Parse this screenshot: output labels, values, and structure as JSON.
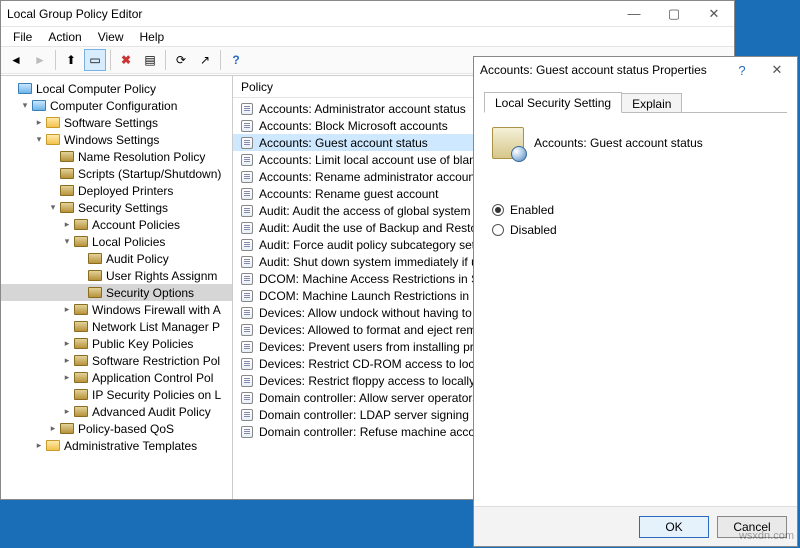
{
  "main": {
    "title": "Local Group Policy Editor",
    "menus": [
      "File",
      "Action",
      "View",
      "Help"
    ],
    "list_header": "Policy",
    "tree": [
      {
        "d": 0,
        "tw": "",
        "ico": "sp",
        "label": "Local Computer Policy"
      },
      {
        "d": 1,
        "tw": "▾",
        "ico": "sp",
        "label": "Computer Configuration"
      },
      {
        "d": 2,
        "tw": "▸",
        "ico": "folder",
        "label": "Software Settings"
      },
      {
        "d": 2,
        "tw": "▾",
        "ico": "folder",
        "label": "Windows Settings"
      },
      {
        "d": 3,
        "tw": "",
        "ico": "dk",
        "label": "Name Resolution Policy"
      },
      {
        "d": 3,
        "tw": "",
        "ico": "dk",
        "label": "Scripts (Startup/Shutdown)"
      },
      {
        "d": 3,
        "tw": "",
        "ico": "dk",
        "label": "Deployed Printers"
      },
      {
        "d": 3,
        "tw": "▾",
        "ico": "dk",
        "label": "Security Settings"
      },
      {
        "d": 4,
        "tw": "▸",
        "ico": "dk",
        "label": "Account Policies"
      },
      {
        "d": 4,
        "tw": "▾",
        "ico": "dk",
        "label": "Local Policies"
      },
      {
        "d": 5,
        "tw": "",
        "ico": "dk",
        "label": "Audit Policy"
      },
      {
        "d": 5,
        "tw": "",
        "ico": "dk",
        "label": "User Rights Assignm"
      },
      {
        "d": 5,
        "tw": "",
        "ico": "dk",
        "label": "Security Options",
        "sel": true
      },
      {
        "d": 4,
        "tw": "▸",
        "ico": "dk",
        "label": "Windows Firewall with A"
      },
      {
        "d": 4,
        "tw": "",
        "ico": "dk",
        "label": "Network List Manager P"
      },
      {
        "d": 4,
        "tw": "▸",
        "ico": "dk",
        "label": "Public Key Policies"
      },
      {
        "d": 4,
        "tw": "▸",
        "ico": "dk",
        "label": "Software Restriction Pol"
      },
      {
        "d": 4,
        "tw": "▸",
        "ico": "dk",
        "label": "Application Control Pol"
      },
      {
        "d": 4,
        "tw": "",
        "ico": "dk",
        "label": "IP Security Policies on L"
      },
      {
        "d": 4,
        "tw": "▸",
        "ico": "dk",
        "label": "Advanced Audit Policy"
      },
      {
        "d": 3,
        "tw": "▸",
        "ico": "dk",
        "label": "Policy-based QoS"
      },
      {
        "d": 2,
        "tw": "▸",
        "ico": "folder",
        "label": "Administrative Templates"
      }
    ],
    "policies": [
      "Accounts: Administrator account status",
      "Accounts: Block Microsoft accounts",
      "Accounts: Guest account status",
      "Accounts: Limit local account use of blan",
      "Accounts: Rename administrator account",
      "Accounts: Rename guest account",
      "Audit: Audit the access of global system o",
      "Audit: Audit the use of Backup and Resto",
      "Audit: Force audit policy subcategory sett",
      "Audit: Shut down system immediately if u",
      "DCOM: Machine Access Restrictions in Se",
      "DCOM: Machine Launch Restrictions in S",
      "Devices: Allow undock without having to",
      "Devices: Allowed to format and eject rem",
      "Devices: Prevent users from installing prin",
      "Devices: Restrict CD-ROM access to locall",
      "Devices: Restrict floppy access to locally l",
      "Domain controller: Allow server operators",
      "Domain controller: LDAP server signing re",
      "Domain controller: Refuse machine accou"
    ],
    "policies_selected_index": 2
  },
  "dialog": {
    "title": "Accounts: Guest account status Properties",
    "tabs": [
      "Local Security Setting",
      "Explain"
    ],
    "active_tab": 0,
    "policy_label": "Accounts: Guest account status",
    "options": [
      "Enabled",
      "Disabled"
    ],
    "selected_option": 0,
    "buttons": {
      "ok": "OK",
      "cancel": "Cancel"
    }
  },
  "watermark": "wsxdn.com"
}
